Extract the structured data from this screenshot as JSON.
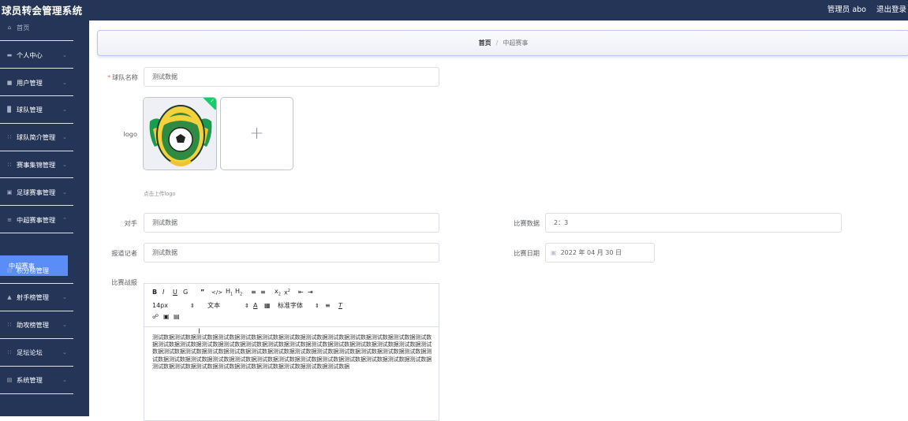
{
  "header": {
    "title": "球员转会管理系统",
    "admin": "管理员 abo",
    "logout": "退出登录"
  },
  "sidebar": {
    "items": [
      {
        "label": "首页",
        "icon": "home-icon"
      },
      {
        "label": "个人中心",
        "icon": "user-icon"
      },
      {
        "label": "用户管理",
        "icon": "table-icon"
      },
      {
        "label": "球队管理",
        "icon": "chart-icon"
      },
      {
        "label": "球队简介管理",
        "icon": "grid-icon"
      },
      {
        "label": "赛事集锦管理",
        "icon": "grid-icon"
      },
      {
        "label": "足球赛事管理",
        "icon": "image-icon"
      },
      {
        "label": "中超赛事管理",
        "icon": "list-icon"
      },
      {
        "label": "积分榜管理",
        "icon": "stack-icon"
      },
      {
        "label": "射手榜管理",
        "icon": "user-icon"
      },
      {
        "label": "助攻榜管理",
        "icon": "grid-icon"
      },
      {
        "label": "足坛论坛",
        "icon": "grid-icon"
      },
      {
        "label": "系统管理",
        "icon": "doc-icon"
      }
    ],
    "active_sub": "中超赛事"
  },
  "breadcrumb": {
    "home": "首页",
    "sep": "/",
    "current": "中超赛事"
  },
  "form": {
    "team_name_label": "球队名称",
    "team_name_value": "测试数据",
    "logo_label": "logo",
    "upload_plus": "+",
    "upload_hint": "点击上传logo",
    "opponent_label": "对手",
    "opponent_value": "测试数据",
    "reporter_label": "报道记者",
    "reporter_value": "测试数据",
    "score_label": "比赛数据",
    "score_value": "2：3",
    "date_label": "比赛日期",
    "date_value": "2022 年 04 月 30 日",
    "report_label": "比赛战报"
  },
  "editor": {
    "font_size": "14px",
    "text_style": "文本",
    "font_family": "标准字体",
    "content": "测试数据测试数据测试数据测试数据测试数据测试数据测试数据测试数据测试数据测试数据测试数据测试数据测试数据测试数据测试数据测试数据测试数据测试数据测试数据测试数据测试数据测试数据测试数据测试数据测试数据测试数据测试数据测试数据测试数据测试数据测试数据测试数据测试数据测试数据测试数据测试数据测试数据测试数据测试数据测试数据测试数据测试数据测试数据测试数据测试数据测试数据测试数据测试数据测试数据测试数据测试数据测试数据测试数据测试数据测试数据测试数据测试数据测试数据测试数据测试数据"
  },
  "colors": {
    "header_bg": "#243558",
    "sidebar_bg": "#243558",
    "active": "#5b8df6",
    "required": "#f56c6c",
    "upload_check": "#13ce66"
  }
}
